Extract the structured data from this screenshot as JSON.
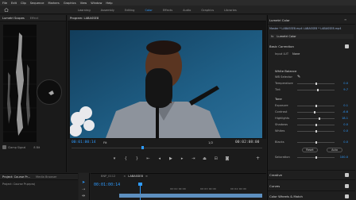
{
  "menu": [
    "File",
    "Edit",
    "Clip",
    "Sequence",
    "Markers",
    "Graphics",
    "View",
    "Window",
    "Help"
  ],
  "workspaces": [
    {
      "label": "Learning",
      "active": false
    },
    {
      "label": "Assembly",
      "active": false
    },
    {
      "label": "Editing",
      "active": false
    },
    {
      "label": "Color",
      "active": true
    },
    {
      "label": "Effects",
      "active": false
    },
    {
      "label": "Audio",
      "active": false
    },
    {
      "label": "Graphics",
      "active": false
    },
    {
      "label": "Libraries",
      "active": false
    }
  ],
  "scopes": {
    "tabs": [
      "Lumetri Scopes",
      "Effect"
    ],
    "clamp_label": "Clamp Signal",
    "bit_label": "8 Bit"
  },
  "program": {
    "tab_label": "Program: LABASSE8",
    "timecode_current": "00:01:00:14",
    "timecode_duration": "00:02:08:00",
    "fit": "Fit",
    "resolution": "1/2",
    "playhead_fraction": 0.37
  },
  "lumetri": {
    "tab_label": "Lumetri Color",
    "source_line": "Master * LABASSE8.mp4   LABASSE8 * LABASSE8.mp4",
    "clip_name": "Lumetri Color",
    "basic_correction": "Basic Correction",
    "input_lut_label": "Input LUT",
    "input_lut_value": "None",
    "white_balance": "White Balance",
    "wb_selector": "WB Selector",
    "tone": "Tone",
    "sliders": [
      {
        "label": "Temperature",
        "value": "0.0",
        "fraction": 0.5
      },
      {
        "label": "Tint",
        "value": "9.7",
        "fraction": 0.55
      },
      {
        "label": "Exposure",
        "value": "0.1",
        "fraction": 0.52
      },
      {
        "label": "Contrast",
        "value": "-6.6",
        "fraction": 0.47
      },
      {
        "label": "Highlights",
        "value": "18.1",
        "fraction": 0.6
      },
      {
        "label": "Shadows",
        "value": "0.0",
        "fraction": 0.5
      },
      {
        "label": "Whites",
        "value": "0.0",
        "fraction": 0.5
      },
      {
        "label": "Blacks",
        "value": "0.0",
        "fraction": 0.5
      }
    ],
    "reset_label": "Reset",
    "auto_label": "Auto",
    "saturation_label": "Saturation",
    "saturation_value": "100.0",
    "creative": "Creative",
    "curves": "Curves",
    "color_wheels": "Color Wheels & Match"
  },
  "project": {
    "tabs": [
      "Project: Course Pr...",
      "Media Browser"
    ],
    "path": "Project: Course Pr.prproj"
  },
  "timeline": {
    "tab_label": "LABASSE8",
    "other_tab": "BNP_0112",
    "timecode": "00:01:00:14",
    "ticks": [
      "00:02:00:00",
      "00:03:00:00",
      "00:04:00:00"
    ]
  },
  "colors": {
    "accent": "#2e9bff",
    "active_workspace": "#2e9bff"
  }
}
